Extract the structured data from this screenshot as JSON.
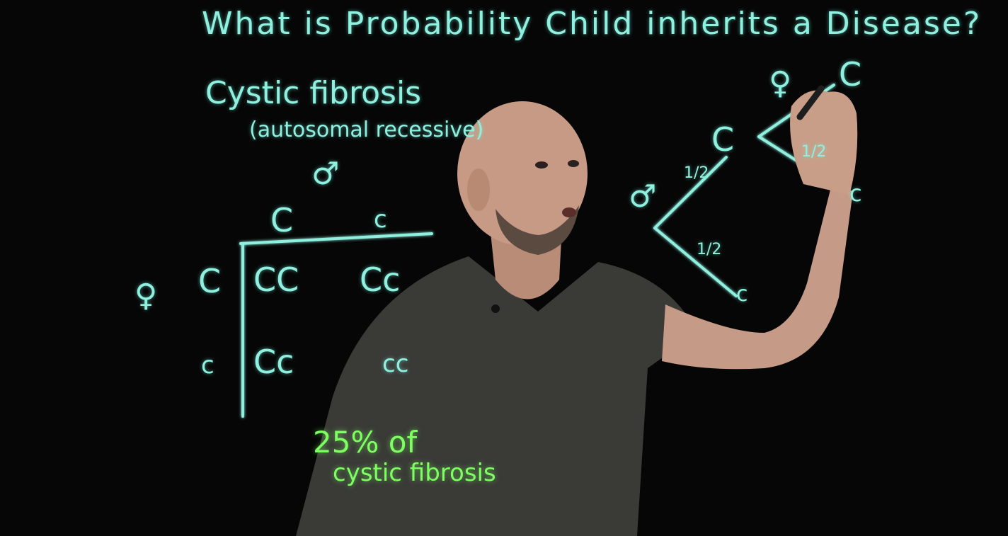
{
  "board": {
    "title": "What is Probability Child inherits a Disease?",
    "subject": "Cystic fibrosis",
    "subject_note": "(autosomal recessive)",
    "male_symbol": "♂",
    "female_symbol": "♀",
    "punnett": {
      "male_alleles": [
        "C",
        "c"
      ],
      "female_alleles": [
        "C",
        "c"
      ],
      "cells": [
        "CC",
        "Cc",
        "Cc",
        "cc"
      ]
    },
    "result_line1": "25% of",
    "result_line2": "cystic fibrosis",
    "tree": {
      "male_branches": [
        "C",
        "c"
      ],
      "male_probs": [
        "1/2",
        "1/2"
      ],
      "female_branches": [
        "C",
        "c"
      ],
      "female_prob": "1/2"
    }
  },
  "colors": {
    "chalk": "#8ff0e0",
    "highlight": "#7dff62",
    "board": "#060606",
    "shirt": "#3a3a37",
    "skin": "#c79a85"
  }
}
